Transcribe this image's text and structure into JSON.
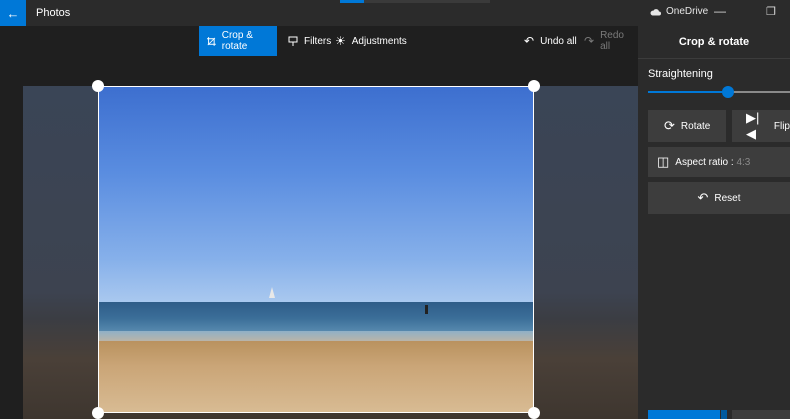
{
  "app": {
    "title": "Photos"
  },
  "titlebar": {
    "onedrive": "OneDrive",
    "minimize_glyph": "—",
    "restore_glyph": "❐",
    "back_glyph": "←"
  },
  "toolbar": {
    "crop_rotate": "Crop & rotate",
    "filters": "Filters",
    "adjustments": "Adjustments",
    "undo_all": "Undo all",
    "redo_all": "Redo all"
  },
  "panel": {
    "title": "Crop & rotate",
    "straightening_label": "Straightening",
    "straightening_value_fraction": 0.56,
    "rotate": "Rotate",
    "flip": "Flip",
    "aspect_ratio_label": "Aspect ratio :",
    "aspect_ratio_value": "4:3",
    "reset": "Reset"
  },
  "colors": {
    "accent": "#0078d7",
    "panel_bg": "#2b2b2b",
    "button_bg": "#3d3d3d"
  },
  "icons": [
    "back-arrow",
    "cloud-icon",
    "crop-icon",
    "filters-icon",
    "adjustments-icon",
    "undo-icon",
    "redo-icon",
    "rotate-icon",
    "flip-icon",
    "aspect-ratio-icon",
    "reset-icon"
  ]
}
